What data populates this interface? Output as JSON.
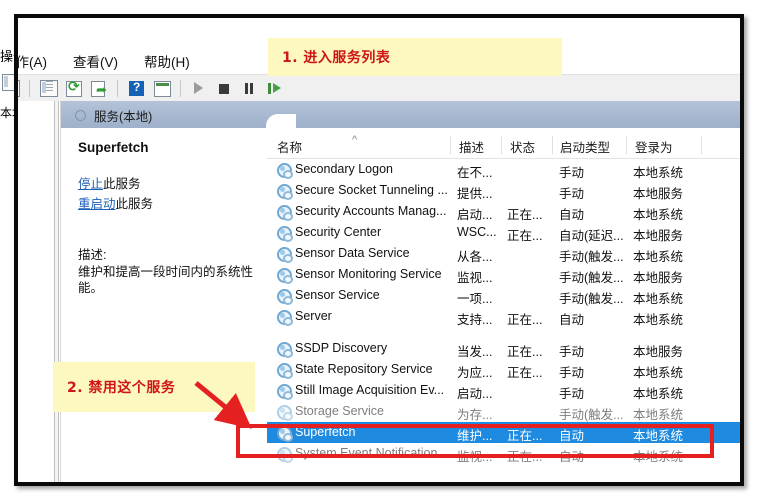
{
  "window": {
    "menubar": [
      "操作(A)",
      "查看(V)",
      "帮助(H)"
    ],
    "toolbar_icons": [
      "properties-icon",
      "refresh-icon",
      "export-list-icon",
      "help-icon",
      "show-action-pane-icon",
      "start-service-icon",
      "stop-service-icon",
      "pause-service-icon",
      "restart-service-icon"
    ],
    "bleed": {
      "tree_label": "本地",
      "left_clipped_menu": "操作(A)"
    }
  },
  "console_band": {
    "title": "服务(本地)",
    "icon": "services-node-icon"
  },
  "details": {
    "service_name": "Superfetch",
    "stop_link_prefix": "停止",
    "stop_link_suffix": "此服务",
    "restart_link_prefix": "重启动",
    "restart_link_suffix": "此服务",
    "description_label": "描述:",
    "description_text": "维护和提高一段时间内的系统性能。"
  },
  "list": {
    "columns": [
      "名称",
      "描述",
      "状态",
      "启动类型",
      "登录为"
    ],
    "sort_indicator": "^",
    "rows": [
      {
        "name": "Secondary Logon",
        "desc": "在不...",
        "status": "",
        "startup": "手动",
        "logon": "本地系统",
        "state": "normal"
      },
      {
        "name": "Secure Socket Tunneling ...",
        "desc": "提供...",
        "status": "",
        "startup": "手动",
        "logon": "本地服务",
        "state": "normal"
      },
      {
        "name": "Security Accounts Manag...",
        "desc": "启动...",
        "status": "正在...",
        "startup": "自动",
        "logon": "本地系统",
        "state": "normal"
      },
      {
        "name": "Security Center",
        "desc": "WSC...",
        "status": "正在...",
        "startup": "自动(延迟...",
        "logon": "本地服务",
        "state": "normal"
      },
      {
        "name": "Sensor Data Service",
        "desc": "从各...",
        "status": "",
        "startup": "手动(触发...",
        "logon": "本地系统",
        "state": "normal"
      },
      {
        "name": "Sensor Monitoring Service",
        "desc": "监视...",
        "status": "",
        "startup": "手动(触发...",
        "logon": "本地服务",
        "state": "normal"
      },
      {
        "name": "Sensor Service",
        "desc": "一项...",
        "status": "",
        "startup": "手动(触发...",
        "logon": "本地系统",
        "state": "normal"
      },
      {
        "name": "Server",
        "desc": "支持...",
        "status": "正在...",
        "startup": "自动",
        "logon": "本地系统",
        "state": "normal"
      },
      {
        "name": "SSDP Discovery",
        "desc": "当发...",
        "status": "正在...",
        "startup": "手动",
        "logon": "本地服务",
        "state": "normal"
      },
      {
        "name": "State Repository Service",
        "desc": "为应...",
        "status": "正在...",
        "startup": "手动",
        "logon": "本地系统",
        "state": "normal"
      },
      {
        "name": "Still Image Acquisition Ev...",
        "desc": "启动...",
        "status": "",
        "startup": "手动",
        "logon": "本地系统",
        "state": "normal"
      },
      {
        "name": "Storage Service",
        "desc": "为存...",
        "status": "",
        "startup": "手动(触发...",
        "logon": "本地系统",
        "state": "faded"
      },
      {
        "name": "Superfetch",
        "desc": "维护...",
        "status": "正在...",
        "startup": "自动",
        "logon": "本地系统",
        "state": "selected"
      },
      {
        "name": "System Event Notification...",
        "desc": "监视...",
        "status": "正在...",
        "startup": "自动",
        "logon": "本地系统",
        "state": "faded"
      }
    ]
  },
  "annotations": [
    {
      "id": "step-1",
      "text": "1. 进入服务列表"
    },
    {
      "id": "step-2",
      "text": "2. 禁用这个服务"
    }
  ],
  "colors": {
    "annotation_bg": "#fdf8c0",
    "annotation_text": "#cf1616",
    "highlight_box": "#e52020",
    "selection_blue": "#1e8ae0",
    "band_blue": "#a8b9d0",
    "link_blue": "#1b5fb4"
  }
}
